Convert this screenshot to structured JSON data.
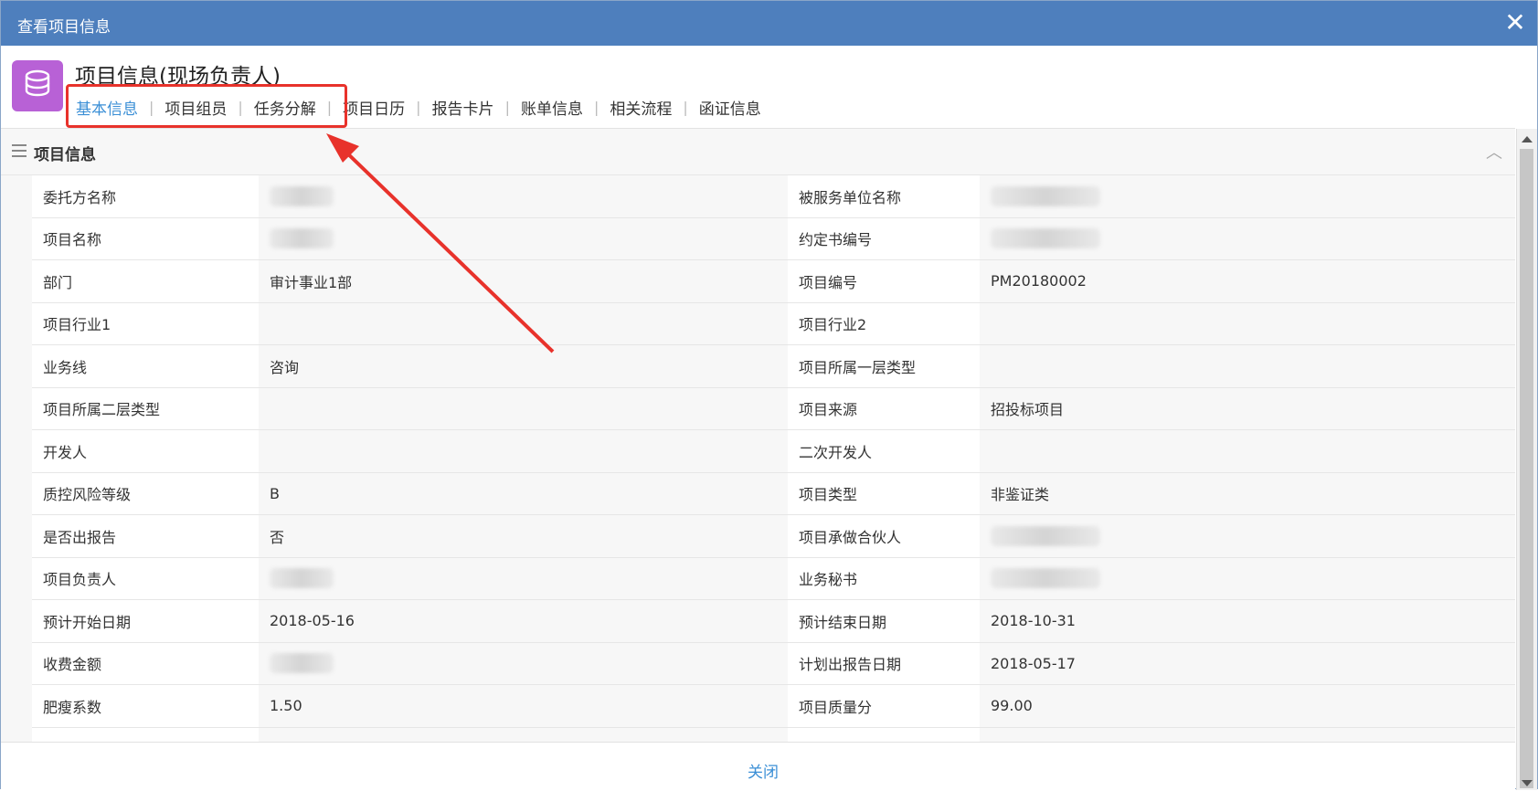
{
  "window": {
    "title": "查看项目信息"
  },
  "header": {
    "page_title": "项目信息(现场负责人)",
    "tabs": [
      {
        "label": "基本信息",
        "active": true
      },
      {
        "label": "项目组员",
        "active": false
      },
      {
        "label": "任务分解",
        "active": false
      },
      {
        "label": "项目日历",
        "active": false
      },
      {
        "label": "报告卡片",
        "active": false
      },
      {
        "label": "账单信息",
        "active": false
      },
      {
        "label": "相关流程",
        "active": false
      },
      {
        "label": "函证信息",
        "active": false
      }
    ]
  },
  "section": {
    "label": "项目信息"
  },
  "fields": [
    [
      {
        "label": "委托方名称",
        "value": "",
        "blurred": true
      },
      {
        "label": "被服务单位名称",
        "value": "",
        "blurred": true
      }
    ],
    [
      {
        "label": "项目名称",
        "value": "",
        "blurred": true
      },
      {
        "label": "约定书编号",
        "value": "",
        "blurred": true
      }
    ],
    [
      {
        "label": "部门",
        "value": "审计事业1部"
      },
      {
        "label": "项目编号",
        "value": "PM20180002"
      }
    ],
    [
      {
        "label": "项目行业1",
        "value": ""
      },
      {
        "label": "项目行业2",
        "value": ""
      }
    ],
    [
      {
        "label": "业务线",
        "value": "咨询"
      },
      {
        "label": "项目所属一层类型",
        "value": ""
      }
    ],
    [
      {
        "label": "项目所属二层类型",
        "value": ""
      },
      {
        "label": "项目来源",
        "value": "招投标项目"
      }
    ],
    [
      {
        "label": "开发人",
        "value": ""
      },
      {
        "label": "二次开发人",
        "value": ""
      }
    ],
    [
      {
        "label": "质控风险等级",
        "value": "B"
      },
      {
        "label": "项目类型",
        "value": "非鉴证类"
      }
    ],
    [
      {
        "label": "是否出报告",
        "value": "否"
      },
      {
        "label": "项目承做合伙人",
        "value": "",
        "blurred": true
      }
    ],
    [
      {
        "label": "项目负责人",
        "value": "",
        "blurred": true
      },
      {
        "label": "业务秘书",
        "value": "",
        "blurred": true
      }
    ],
    [
      {
        "label": "预计开始日期",
        "value": "2018-05-16"
      },
      {
        "label": "预计结束日期",
        "value": "2018-10-31"
      }
    ],
    [
      {
        "label": "收费金额",
        "value": "",
        "blurred": true
      },
      {
        "label": "计划出报告日期",
        "value": "2018-05-17"
      }
    ],
    [
      {
        "label": "肥瘦系数",
        "value": "1.50"
      },
      {
        "label": "项目质量分",
        "value": "99.00"
      }
    ],
    [
      {
        "label": "",
        "value": ""
      },
      {
        "label": "",
        "value": ""
      }
    ]
  ],
  "footer": {
    "close_label": "关闭"
  },
  "colors": {
    "titlebar": "#4e7fbd",
    "active_tab": "#3b8fd6",
    "annotation": "#e8322b",
    "app_icon": "#b861d6"
  },
  "icons": {
    "app": "database-icon",
    "close": "close-icon",
    "section": "menu-icon",
    "collapse": "chevron-up-icon"
  }
}
